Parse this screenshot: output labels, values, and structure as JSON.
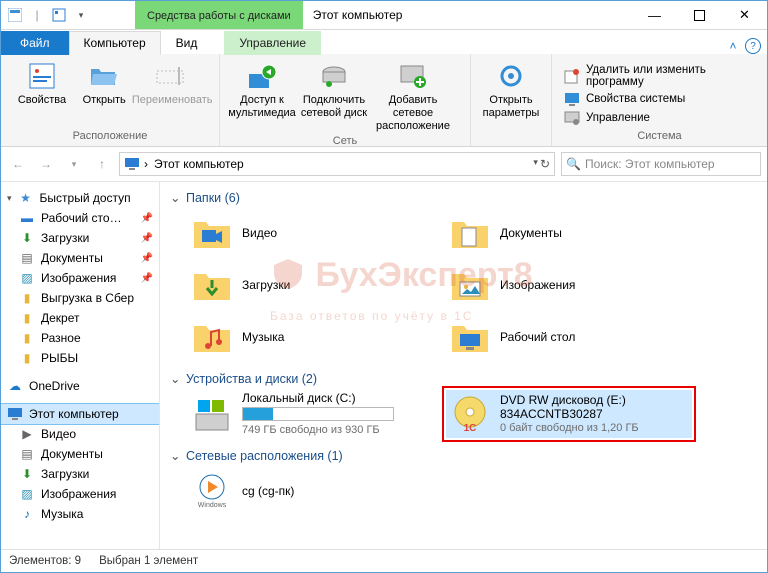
{
  "titlebar": {
    "tools_tab": "Средства работы с дисками",
    "title": "Этот компьютер"
  },
  "tabs": {
    "file": "Файл",
    "computer": "Компьютер",
    "view": "Вид",
    "manage": "Управление"
  },
  "ribbon": {
    "groups": {
      "location": {
        "label": "Расположение",
        "properties": "Свойства",
        "open": "Открыть",
        "rename": "Переименовать"
      },
      "network": {
        "label": "Сеть",
        "media": "Доступ к\nмультимедиа",
        "map_drive": "Подключить\nсетевой диск",
        "add_net": "Добавить сетевое\nрасположение"
      },
      "open_params": {
        "label": "",
        "open_settings": "Открыть\nпараметры"
      },
      "system": {
        "label": "Система",
        "uninstall": "Удалить или изменить программу",
        "sysprops": "Свойства системы",
        "manage": "Управление"
      }
    }
  },
  "address": {
    "crumb": "Этот компьютер",
    "search_placeholder": "Поиск: Этот компьютер"
  },
  "nav": {
    "quick": "Быстрый доступ",
    "items_q": [
      "Рабочий сто…",
      "Загрузки",
      "Документы",
      "Изображения",
      "Выгрузка в Сбер",
      "Декрет",
      "Разное",
      "РЫБЫ"
    ],
    "onedrive": "OneDrive",
    "thispc": "Этот компьютер",
    "items_pc": [
      "Видео",
      "Документы",
      "Загрузки",
      "Изображения",
      "Музыка"
    ]
  },
  "content": {
    "folders_head": "Папки (6)",
    "folders": [
      "Видео",
      "Документы",
      "Загрузки",
      "Изображения",
      "Музыка",
      "Рабочий стол"
    ],
    "devices_head": "Устройства и диски (2)",
    "drive_c": {
      "title": "Локальный диск (C:)",
      "sub": "749 ГБ свободно из 930 ГБ",
      "fill_pct": 20
    },
    "dvd": {
      "title": "DVD RW дисковод (E:)",
      "subtitle": "834ACCNTB30287",
      "sub": "0 байт свободно из 1,20 ГБ"
    },
    "netloc_head": "Сетевые расположения (1)",
    "netloc": {
      "title": "cg (cg-пк)"
    }
  },
  "status": {
    "count": "Элементов: 9",
    "selected": "Выбран 1 элемент"
  },
  "watermark": {
    "brand": "БухЭксперт8",
    "tag": "База ответов по учёту в 1С"
  }
}
